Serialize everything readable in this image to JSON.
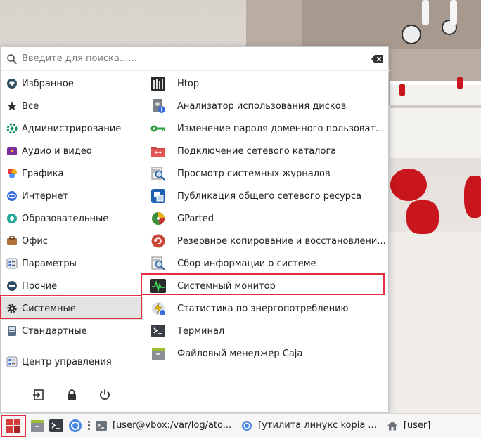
{
  "search": {
    "placeholder": "Введите для поиска......"
  },
  "categories": [
    {
      "label": "Избранное",
      "icon": "heart-icon"
    },
    {
      "label": "Все",
      "icon": "star-icon"
    },
    {
      "label": "Администрирование",
      "icon": "admin-icon"
    },
    {
      "label": "Аудио и видео",
      "icon": "multimedia-icon"
    },
    {
      "label": "Графика",
      "icon": "graphics-icon"
    },
    {
      "label": "Интернет",
      "icon": "internet-icon"
    },
    {
      "label": "Образовательные",
      "icon": "education-icon"
    },
    {
      "label": "Офис",
      "icon": "office-icon"
    },
    {
      "label": "Параметры",
      "icon": "settings-icon"
    },
    {
      "label": "Прочие",
      "icon": "other-icon"
    },
    {
      "label": "Системные",
      "icon": "gear-icon",
      "selected": true
    },
    {
      "label": "Стандартные",
      "icon": "accessories-icon"
    }
  ],
  "control_center": {
    "label": "Центр управления",
    "icon": "control-center-icon"
  },
  "session": {
    "logout": "logout-icon",
    "lock": "lock-icon",
    "shutdown": "power-icon"
  },
  "apps": [
    {
      "label": "Htop",
      "icon": "htop-icon"
    },
    {
      "label": "Анализатор использования дисков",
      "icon": "disk-analyzer-icon"
    },
    {
      "label": "Изменение пароля доменного пользоват...",
      "icon": "key-icon"
    },
    {
      "label": "Подключение сетевого каталога",
      "icon": "network-folder-icon"
    },
    {
      "label": "Просмотр системных журналов",
      "icon": "log-viewer-icon"
    },
    {
      "label": "Публикация общего сетевого ресурса",
      "icon": "share-icon"
    },
    {
      "label": "GParted",
      "icon": "gparted-icon"
    },
    {
      "label": "Резервное копирование и восстановлени...",
      "icon": "backup-icon"
    },
    {
      "label": "Сбор информации о системе",
      "icon": "system-info-icon"
    },
    {
      "label": "Системный монитор",
      "icon": "system-monitor-icon",
      "highlighted": true
    },
    {
      "label": "Статистика по энергопотреблению",
      "icon": "power-statistics-icon"
    },
    {
      "label": "Терминал",
      "icon": "terminal-icon"
    },
    {
      "label": "Файловый менеджер Caja",
      "icon": "file-manager-icon"
    }
  ],
  "taskbar": {
    "tasks": [
      {
        "label": "[user@vbox:/var/log/ato...",
        "icon": "terminal-icon"
      },
      {
        "label": "[утилита линукс kopia ...",
        "icon": "chromium-icon"
      },
      {
        "label": "[user]",
        "icon": "home-icon"
      }
    ]
  },
  "colors": {
    "highlight": "#e03040",
    "selected_bg": "#e3e3e3",
    "menu_bg": "#ffffff"
  }
}
